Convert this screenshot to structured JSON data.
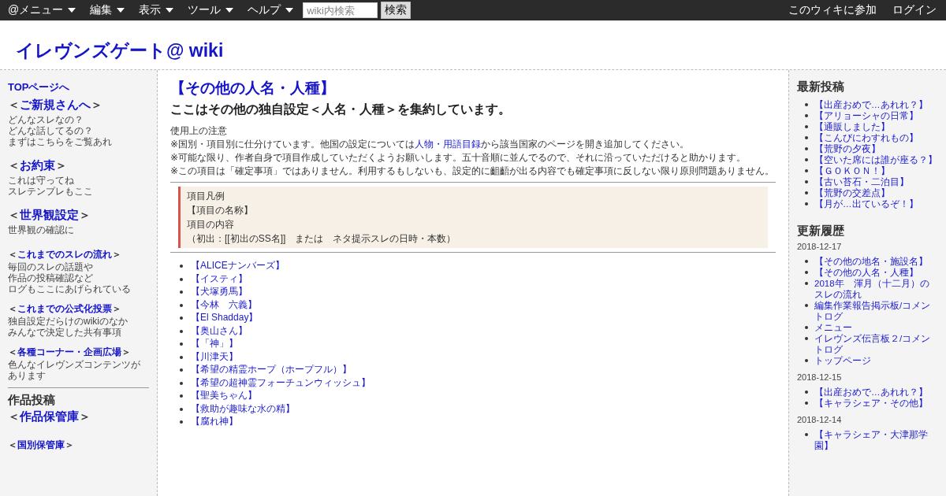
{
  "topbar": {
    "menus": [
      {
        "label": "@メニュー"
      },
      {
        "label": "編集"
      },
      {
        "label": "表示"
      },
      {
        "label": "ツール"
      },
      {
        "label": "ヘルプ"
      }
    ],
    "search": {
      "placeholder": "wiki内検索",
      "button": "検索"
    },
    "right_links": [
      "このウィキに参加",
      "ログイン"
    ]
  },
  "site_title": "イレヴンズゲート@ wiki",
  "left_sidebar": {
    "top_link": "TOPページへ",
    "sections": [
      {
        "kind": "large",
        "prefix": "＜",
        "label": "ご新規さんへ",
        "suffix": "＞",
        "description": [
          "どんなスレなの？",
          "どんな話してるの？",
          "まずはこちらをご覧あれ"
        ]
      },
      {
        "kind": "large",
        "prefix": "＜",
        "label": "お約束",
        "suffix": "＞",
        "description": [
          "これは守ってね",
          "スレテンプレもここ"
        ]
      },
      {
        "kind": "large",
        "prefix": "＜",
        "label": "世界観設定",
        "suffix": "＞",
        "description": [
          "世界観の確認に"
        ]
      },
      {
        "kind": "small",
        "prefix": "＜",
        "label": "これまでのスレの流れ",
        "suffix": "＞",
        "description": [
          "毎回のスレの話題や",
          "作品の投稿確認など",
          "ログもここにあげられている"
        ]
      },
      {
        "kind": "small",
        "prefix": "＜",
        "label": "これまでの公式化投票",
        "suffix": "＞",
        "description": [
          "独自設定だらけのwikiのなか",
          "みんなで決定した共有事項"
        ]
      },
      {
        "kind": "small",
        "prefix": "＜",
        "label": "各種コーナー・企画広場",
        "suffix": "＞",
        "description": [
          "色んなイレヴンズコンテンツがあります"
        ]
      }
    ],
    "heading": "作品投稿",
    "sections_2": [
      {
        "kind": "large",
        "prefix": "＜",
        "label": "作品保管庫",
        "suffix": "＞"
      },
      {
        "kind": "small",
        "prefix": "＜",
        "label": "国別保管庫",
        "suffix": "＞"
      }
    ]
  },
  "main": {
    "title": "【その他の人名・人種】",
    "subtitle": "ここはその他の独自設定＜人名・人種＞を集約しています。",
    "notes_heading": "使用上の注意",
    "notes": [
      {
        "before": "※国別・項目別に仕分けています。他国の設定については",
        "link": "人物・用語目録",
        "after": "から該当国家のページを開き追加してください。"
      },
      {
        "before": "※可能な限り、作者自身で項目作成していただくようお願いします。五十音順に並んでるので、それに沿っていただけると助かります。"
      },
      {
        "before": "※この項目は「確定事項」ではありません。利用するもしないも、設定的に齟齬が出る内容でも確定事項に反しない限り原則問題ありません。"
      }
    ],
    "legend": [
      "項目凡例",
      "【項目の名称】",
      "項目の内容",
      "（初出：[[初出のSS名]]　または　ネタ提示スレの日時・本数）"
    ],
    "entries": [
      "【ALICEナンバーズ】",
      "【イスティ】",
      "【犬塚勇馬】",
      "【今林　六義】",
      "【El Shadday】",
      "【奥山さん】",
      "【「神」】",
      "【川津天】",
      "【希望の精霊ホープ（ホープフル）】",
      "【希望の超神霊フォーチュンウィッシュ】",
      "【聖美ちゃん】",
      "【救助が趣味な水の精】",
      "【腐れ神】"
    ]
  },
  "right_sidebar": {
    "latest_heading": "最新投稿",
    "latest": [
      "【出産おめで…あれれ？】",
      "【アリョーシャの日常】",
      "【通販しました】",
      "【こんびにわすれもの】",
      "【荒野の夕夜】",
      "【空いた席には誰が座る？】",
      "【ＧＯＫＯＮ！】",
      "【古い苔石・二泊目】",
      "【荒野の交差点】",
      "【月が…出ているぞ！】"
    ],
    "history_heading": "更新履歴",
    "history": [
      {
        "date": "2018-12-17",
        "items": [
          "【その他の地名・施設名】",
          "【その他の人名・人種】",
          "2018年　渾月（十二月）のスレの流れ",
          "編集作業報告掲示板/コメントログ",
          "メニュー",
          "イレヴンズ伝言板２/コメントログ",
          "トップページ"
        ]
      },
      {
        "date": "2018-12-15",
        "items": [
          "【出産おめで…あれれ？】",
          "【キャラシェア・その他】"
        ]
      },
      {
        "date": "2018-12-14",
        "items": [
          "【キャラシェア・大津那学園】"
        ]
      }
    ]
  }
}
